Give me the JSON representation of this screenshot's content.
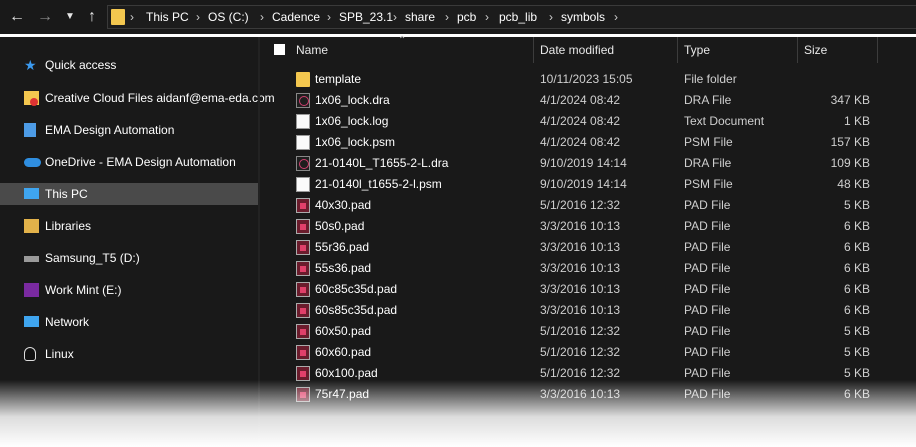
{
  "breadcrumb": [
    "This PC",
    "OS (C:)",
    "Cadence",
    "SPB_23.1",
    "share",
    "pcb",
    "pcb_lib",
    "symbols"
  ],
  "nav": {
    "items": [
      {
        "label": "Quick access",
        "icon": "star-icon"
      },
      {
        "label": "Creative Cloud Files  aidanf@ema-eda.com",
        "icon": "creative-cloud-icon"
      },
      {
        "label": "EMA Design Automation",
        "icon": "building-icon"
      },
      {
        "label": "OneDrive - EMA Design Automation",
        "icon": "cloud-icon"
      },
      {
        "label": "This PC",
        "icon": "computer-icon"
      },
      {
        "label": "Libraries",
        "icon": "library-icon"
      },
      {
        "label": "Samsung_T5 (D:)",
        "icon": "drive-icon"
      },
      {
        "label": "Work Mint (E:)",
        "icon": "sd-drive-icon"
      },
      {
        "label": "Network",
        "icon": "network-icon"
      },
      {
        "label": "Linux",
        "icon": "linux-icon"
      }
    ]
  },
  "columns": {
    "name": "Name",
    "date": "Date modified",
    "type": "Type",
    "size": "Size"
  },
  "files": [
    {
      "name": "template",
      "date": "10/11/2023 15:05",
      "type": "File folder",
      "size": "",
      "icon": "folder"
    },
    {
      "name": "1x06_lock.dra",
      "date": "4/1/2024 08:42",
      "type": "DRA File",
      "size": "347 KB",
      "icon": "dra"
    },
    {
      "name": "1x06_lock.log",
      "date": "4/1/2024 08:42",
      "type": "Text Document",
      "size": "1 KB",
      "icon": "doc"
    },
    {
      "name": "1x06_lock.psm",
      "date": "4/1/2024 08:42",
      "type": "PSM File",
      "size": "157 KB",
      "icon": "doc"
    },
    {
      "name": "21-0140L_T1655-2-L.dra",
      "date": "9/10/2019 14:14",
      "type": "DRA File",
      "size": "109 KB",
      "icon": "dra"
    },
    {
      "name": "21-0140l_t1655-2-l.psm",
      "date": "9/10/2019 14:14",
      "type": "PSM File",
      "size": "48 KB",
      "icon": "doc"
    },
    {
      "name": "40x30.pad",
      "date": "5/1/2016 12:32",
      "type": "PAD File",
      "size": "5 KB",
      "icon": "pad"
    },
    {
      "name": "50s0.pad",
      "date": "3/3/2016 10:13",
      "type": "PAD File",
      "size": "6 KB",
      "icon": "pad"
    },
    {
      "name": "55r36.pad",
      "date": "3/3/2016 10:13",
      "type": "PAD File",
      "size": "6 KB",
      "icon": "pad"
    },
    {
      "name": "55s36.pad",
      "date": "3/3/2016 10:13",
      "type": "PAD File",
      "size": "6 KB",
      "icon": "pad"
    },
    {
      "name": "60c85c35d.pad",
      "date": "3/3/2016 10:13",
      "type": "PAD File",
      "size": "6 KB",
      "icon": "pad"
    },
    {
      "name": "60s85c35d.pad",
      "date": "3/3/2016 10:13",
      "type": "PAD File",
      "size": "6 KB",
      "icon": "pad"
    },
    {
      "name": "60x50.pad",
      "date": "5/1/2016 12:32",
      "type": "PAD File",
      "size": "5 KB",
      "icon": "pad"
    },
    {
      "name": "60x60.pad",
      "date": "5/1/2016 12:32",
      "type": "PAD File",
      "size": "5 KB",
      "icon": "pad"
    },
    {
      "name": "60x100.pad",
      "date": "5/1/2016 12:32",
      "type": "PAD File",
      "size": "5 KB",
      "icon": "pad"
    },
    {
      "name": "75r47.pad",
      "date": "3/3/2016 10:13",
      "type": "PAD File",
      "size": "6 KB",
      "icon": "pad"
    }
  ]
}
